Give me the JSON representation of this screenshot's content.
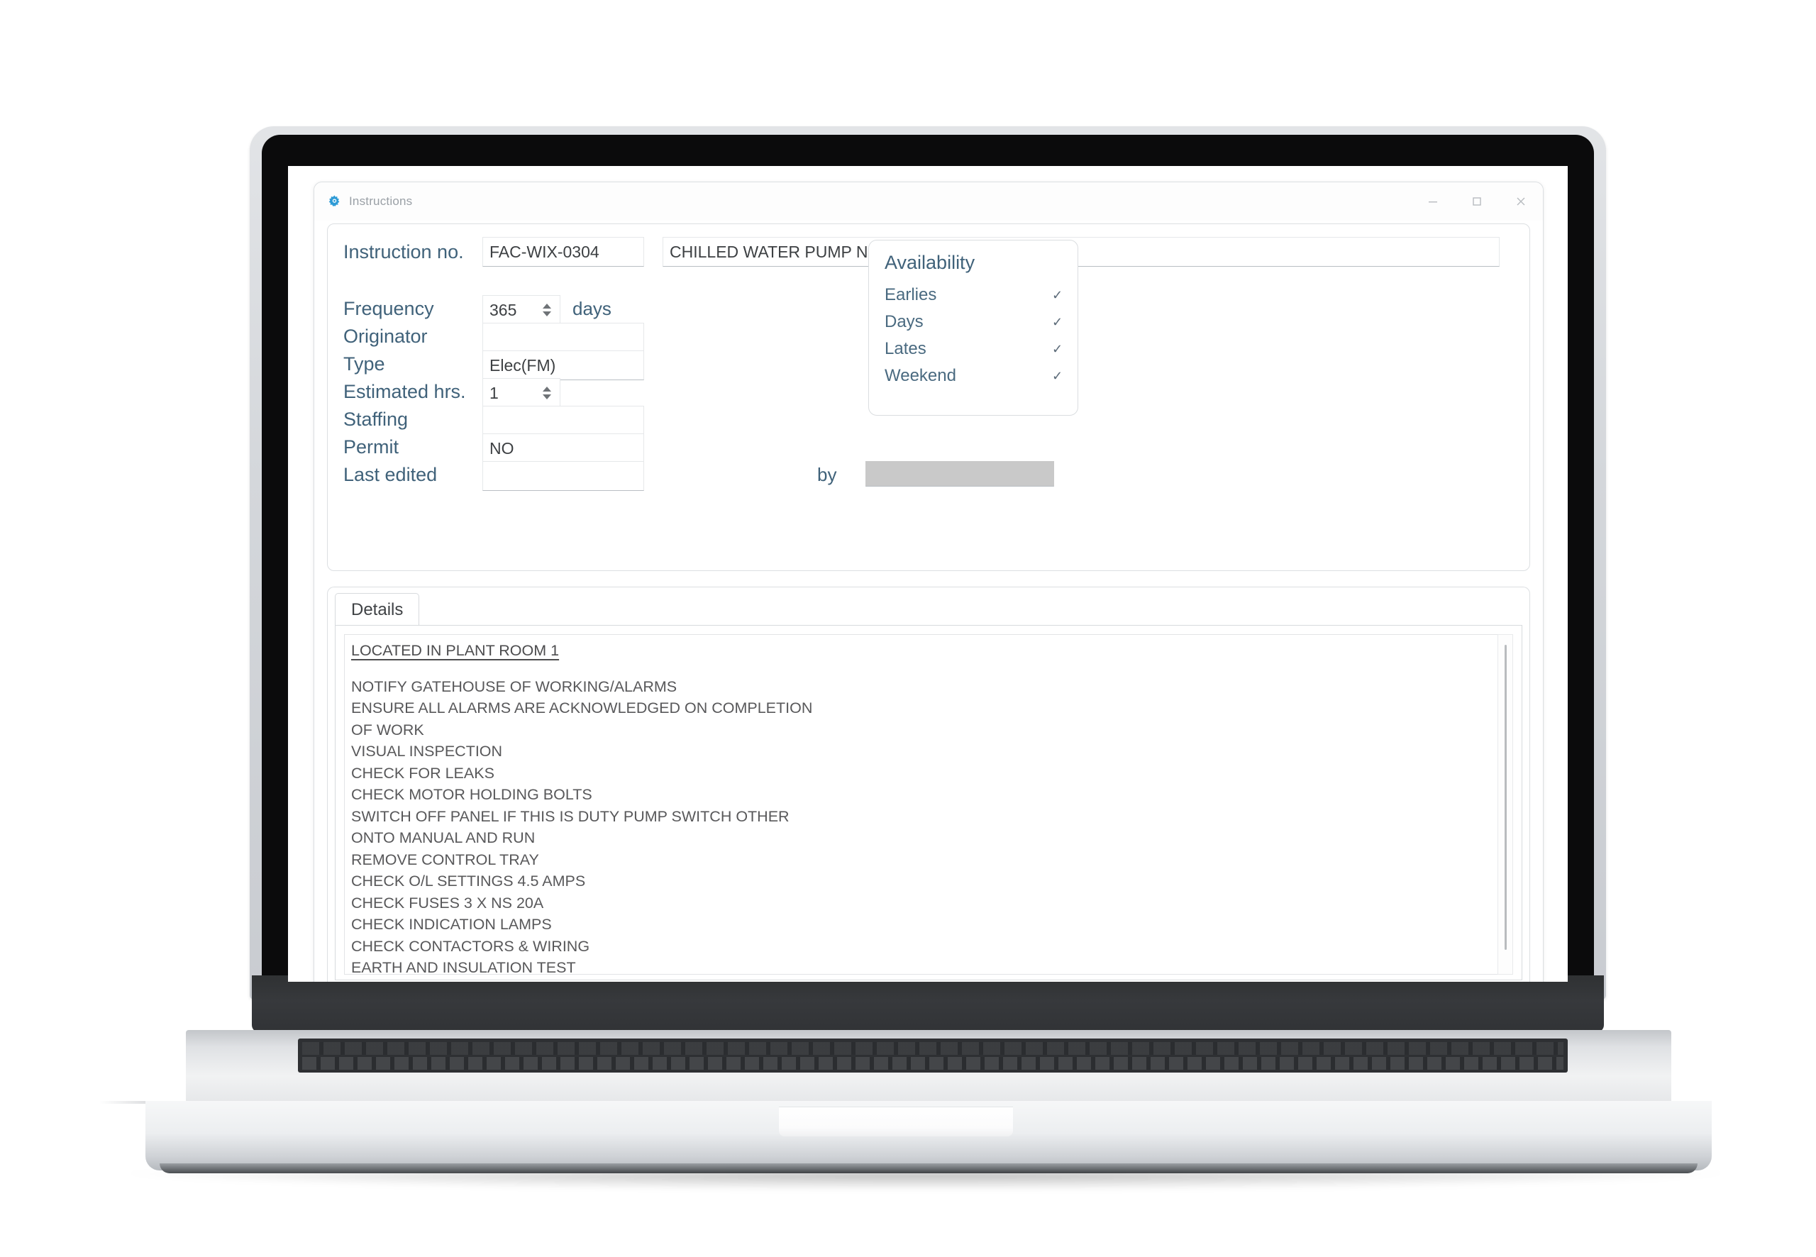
{
  "window": {
    "title": "Instructions",
    "icon": "gear-icon",
    "controls": {
      "minimize": "minimize-icon",
      "maximize": "maximize-icon",
      "close": "close-icon"
    }
  },
  "form": {
    "instruction_no": {
      "label": "Instruction no.",
      "value": "FAC-WIX-0304",
      "description_value": "CHILLED WATER PUMP NO1 ANNUAL ELECTRICAL"
    },
    "frequency": {
      "label": "Frequency",
      "value": "365",
      "unit": "days"
    },
    "originator": {
      "label": "Originator",
      "value": ""
    },
    "type": {
      "label": "Type",
      "value": "Elec(FM)"
    },
    "estimated_hrs": {
      "label": "Estimated hrs.",
      "value": "1"
    },
    "staffing": {
      "label": "Staffing",
      "value": ""
    },
    "permit": {
      "label": "Permit",
      "value": "NO"
    },
    "last_edited": {
      "label": "Last edited",
      "value": "",
      "by_label": "by",
      "by_value": ""
    }
  },
  "availability": {
    "title": "Availability",
    "items": [
      {
        "label": "Earlies",
        "checked": "✓"
      },
      {
        "label": "Days",
        "checked": "✓"
      },
      {
        "label": "Lates",
        "checked": "✓"
      },
      {
        "label": "Weekend",
        "checked": "✓"
      }
    ]
  },
  "details": {
    "tab_label": "Details",
    "heading": "LOCATED IN PLANT ROOM 1",
    "lines": [
      "NOTIFY GATEHOUSE OF WORKING/ALARMS",
      "ENSURE ALL ALARMS ARE ACKNOWLEDGED ON COMPLETION",
      "OF WORK",
      "VISUAL INSPECTION",
      "CHECK FOR LEAKS",
      "CHECK MOTOR HOLDING BOLTS",
      "SWITCH OFF PANEL IF THIS IS DUTY PUMP SWITCH OTHER",
      "ONTO MANUAL AND RUN",
      "REMOVE CONTROL TRAY",
      "CHECK O/L SETTINGS 4.5 AMPS",
      "CHECK FUSES 3 X NS 20A",
      "CHECK INDICATION LAMPS",
      "CHECK CONTACTORS & WIRING",
      "EARTH AND INSULATION TEST"
    ]
  },
  "colors": {
    "label_blue": "#40627a",
    "icon_blue": "#2e9bd6",
    "title_grey": "#9aa0a6",
    "field_text": "#3d4043",
    "memo_text": "#58585a",
    "readonly_grey": "#c9c9c9"
  }
}
